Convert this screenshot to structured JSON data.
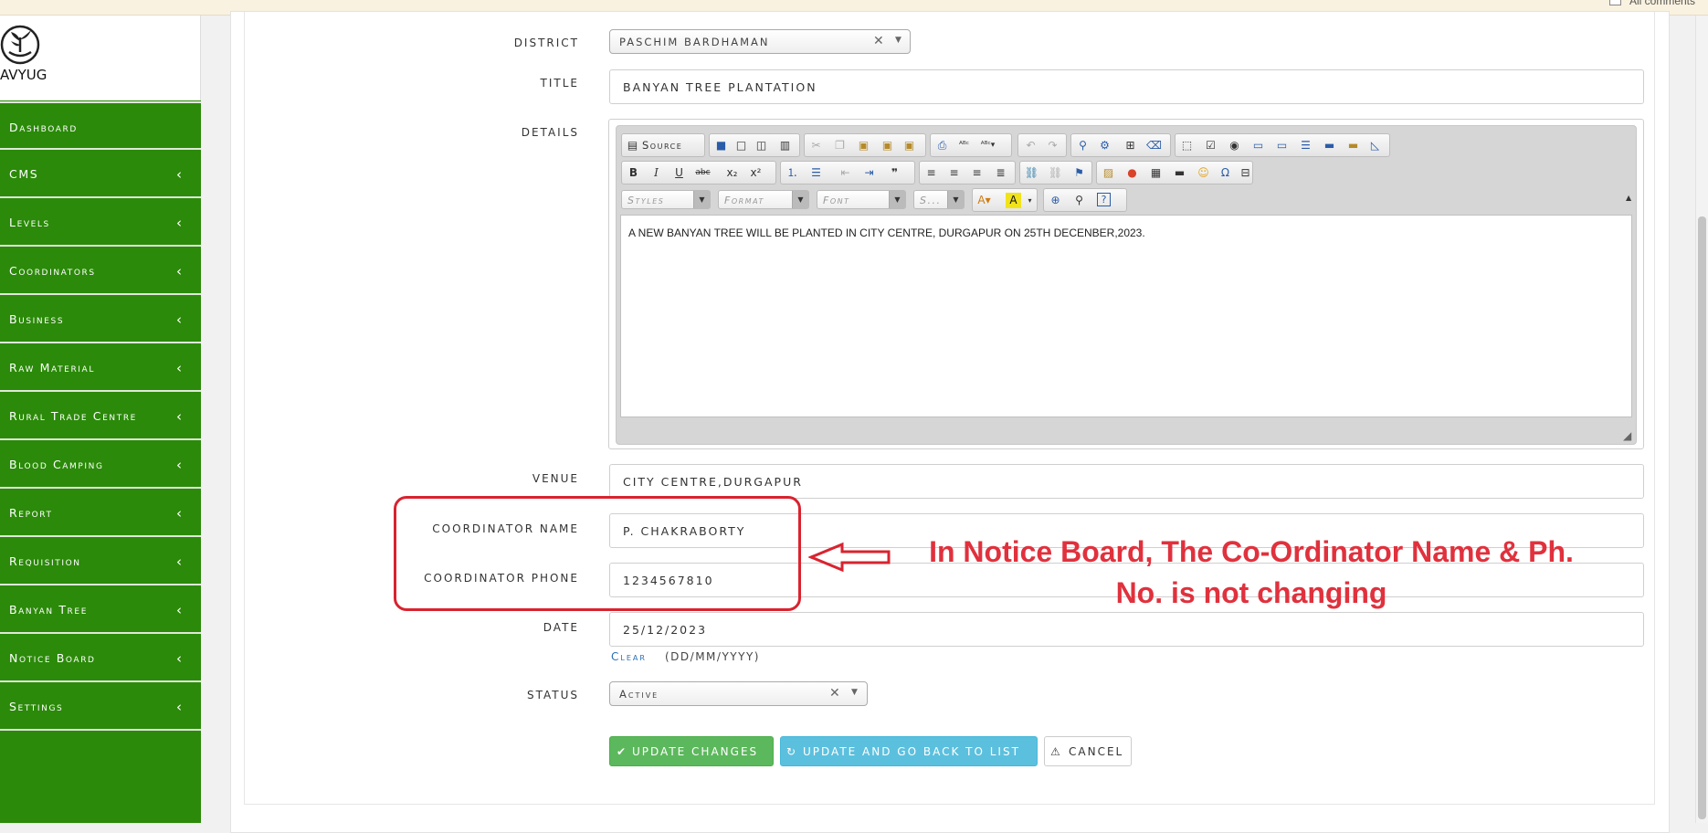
{
  "topbar": {
    "label": "All comments"
  },
  "brand": {
    "logo_text": "AVYUG"
  },
  "sidebar": {
    "items": [
      {
        "label": "Dashboard",
        "has_children": false
      },
      {
        "label": "CMS",
        "has_children": true
      },
      {
        "label": "Levels",
        "has_children": true
      },
      {
        "label": "Coordinators",
        "has_children": true
      },
      {
        "label": "Business",
        "has_children": true
      },
      {
        "label": "Raw Material",
        "has_children": true
      },
      {
        "label": "Rural Trade Centre",
        "has_children": true
      },
      {
        "label": "Blood Camping",
        "has_children": true
      },
      {
        "label": "Report",
        "has_children": true
      },
      {
        "label": "Requisition",
        "has_children": true
      },
      {
        "label": "Banyan Tree",
        "has_children": true
      },
      {
        "label": "Notice Board",
        "has_children": true
      },
      {
        "label": "Settings",
        "has_children": true
      }
    ],
    "chevron": "‹"
  },
  "form": {
    "district": {
      "label": "DISTRICT",
      "value": "PASCHIM BARDHAMAN"
    },
    "title": {
      "label": "TITLE",
      "value": "BANYAN TREE PLANTATION"
    },
    "details": {
      "label": "DETAILS",
      "toolbar": {
        "source_label": "Source",
        "styles_label": "Styles",
        "format_label": "Format",
        "font_label": "Font",
        "size_label": "S..."
      },
      "content": "A NEW BANYAN TREE WILL BE PLANTED IN CITY CENTRE, DURGAPUR ON 25TH DECENBER,2023."
    },
    "venue": {
      "label": "VENUE",
      "value": "CITY CENTRE,DURGAPUR"
    },
    "coordinator_name": {
      "label": "COORDINATOR NAME",
      "value": "P. CHAKRABORTY"
    },
    "coordinator_phone": {
      "label": "COORDINATOR PHONE",
      "value": "1234567810"
    },
    "date": {
      "label": "DATE",
      "value": "25/12/2023",
      "clear_label": "Clear",
      "format_hint": "(DD/MM/YYYY)"
    },
    "status": {
      "label": "STATUS",
      "value": "Active"
    }
  },
  "actions": {
    "update_label": "UPDATE CHANGES",
    "update_back_label": "UPDATE AND GO BACK TO LIST",
    "cancel_label": "CANCEL"
  },
  "annotation": {
    "line1": "In Notice Board, The Co-Ordinator Name & Ph.",
    "line2": "No. is not changing",
    "color": "#e0313d"
  },
  "colors": {
    "sidebar": "#2b8a09",
    "button_green": "#5cb85c",
    "button_blue": "#5bc0de"
  }
}
